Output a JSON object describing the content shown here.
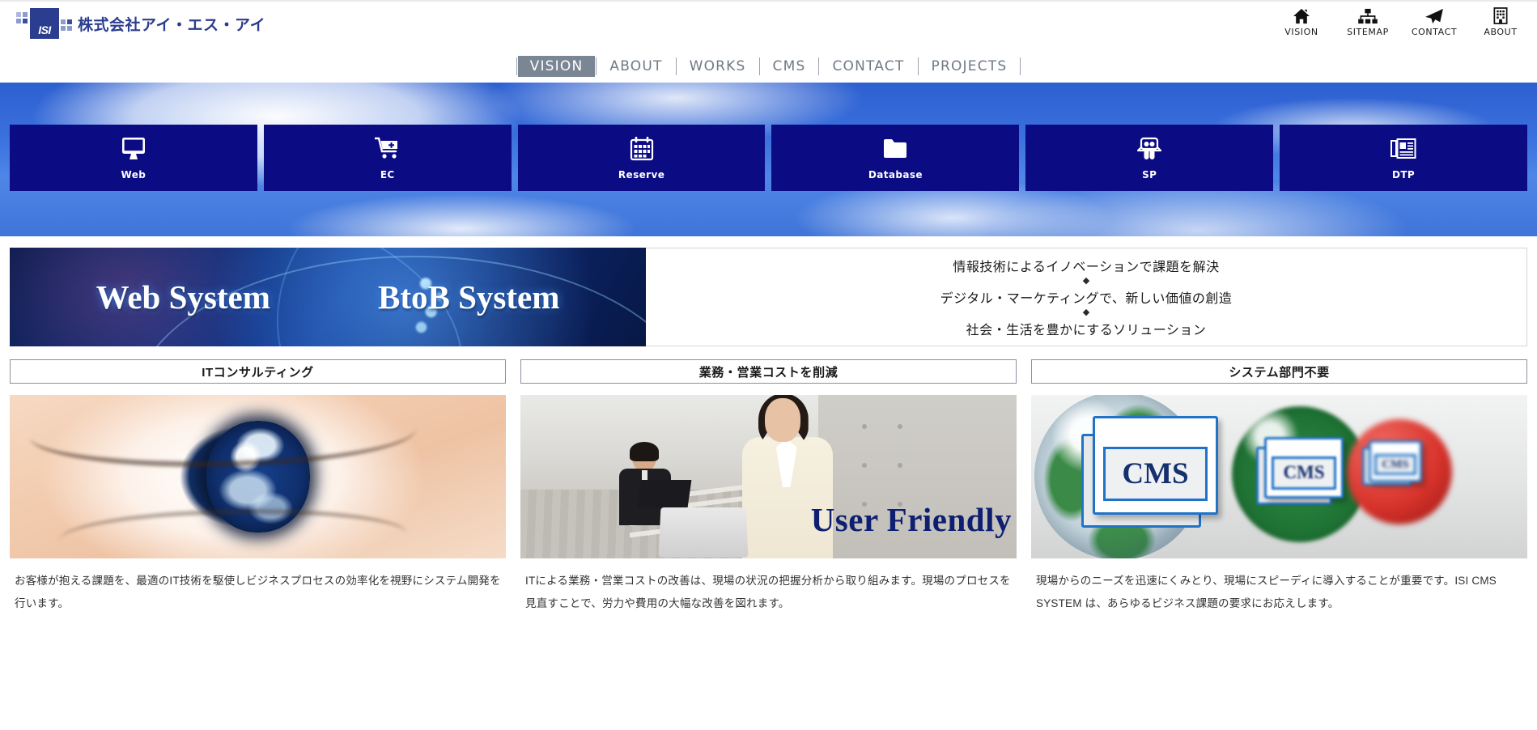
{
  "header": {
    "logo_text": "ISI",
    "company_name": "株式会社アイ・エス・アイ",
    "util_nav": [
      {
        "label": "VISION",
        "icon": "home-icon"
      },
      {
        "label": "SITEMAP",
        "icon": "sitemap-icon"
      },
      {
        "label": "CONTACT",
        "icon": "paper-plane-icon"
      },
      {
        "label": "ABOUT",
        "icon": "building-icon"
      }
    ]
  },
  "main_nav": {
    "items": [
      {
        "label": "VISION",
        "active": true
      },
      {
        "label": "ABOUT",
        "active": false
      },
      {
        "label": "WORKS",
        "active": false
      },
      {
        "label": "CMS",
        "active": false
      },
      {
        "label": "CONTACT",
        "active": false
      },
      {
        "label": "PROJECTS",
        "active": false
      }
    ]
  },
  "service_tiles": [
    {
      "label": "Web",
      "icon": "monitor-icon"
    },
    {
      "label": "EC",
      "icon": "shopping-cart-plus-icon"
    },
    {
      "label": "Reserve",
      "icon": "calendar-icon"
    },
    {
      "label": "Database",
      "icon": "folder-icon"
    },
    {
      "label": "SP",
      "icon": "people-presentation-icon"
    },
    {
      "label": "DTP",
      "icon": "newspaper-icon"
    }
  ],
  "hero": {
    "banner_text_left": "Web System",
    "banner_text_right": "BtoB System",
    "messages": [
      "情報技術によるイノベーションで課題を解決",
      "デジタル・マーケティングで、新しい価値の創造",
      "社会・生活を豊かにするソリューション"
    ],
    "separator": "◆"
  },
  "cards": [
    {
      "heading": "ITコンサルティング",
      "image_name": "eye-earth-image",
      "body": "お客様が抱える課題を、最適のIT技術を駆使しビジネスプロセスの効率化を視野にシステム開発を行います。"
    },
    {
      "heading": "業務・営業コストを削減",
      "image_name": "office-user-friendly-image",
      "image_caption": "User Friendly",
      "body": "ITによる業務・営業コストの改善は、現場の状況の把握分析から取り組みます。現場のプロセスを見直すことで、労力や費用の大幅な改善を図れます。"
    },
    {
      "heading": "システム部門不要",
      "image_name": "cms-globes-image",
      "image_caption": "CMS",
      "body": "現場からのニーズを迅速にくみとり、現場にスピーディに導入することが重要です。ISI CMS SYSTEM は、あらゆるビジネス課題の要求にお応えします。"
    }
  ],
  "colors": {
    "brand_blue": "#2b3d8f",
    "tile_navy": "#0b0b83",
    "nav_active_bg": "#7b8694",
    "sky_blue": "#3a70dd"
  }
}
